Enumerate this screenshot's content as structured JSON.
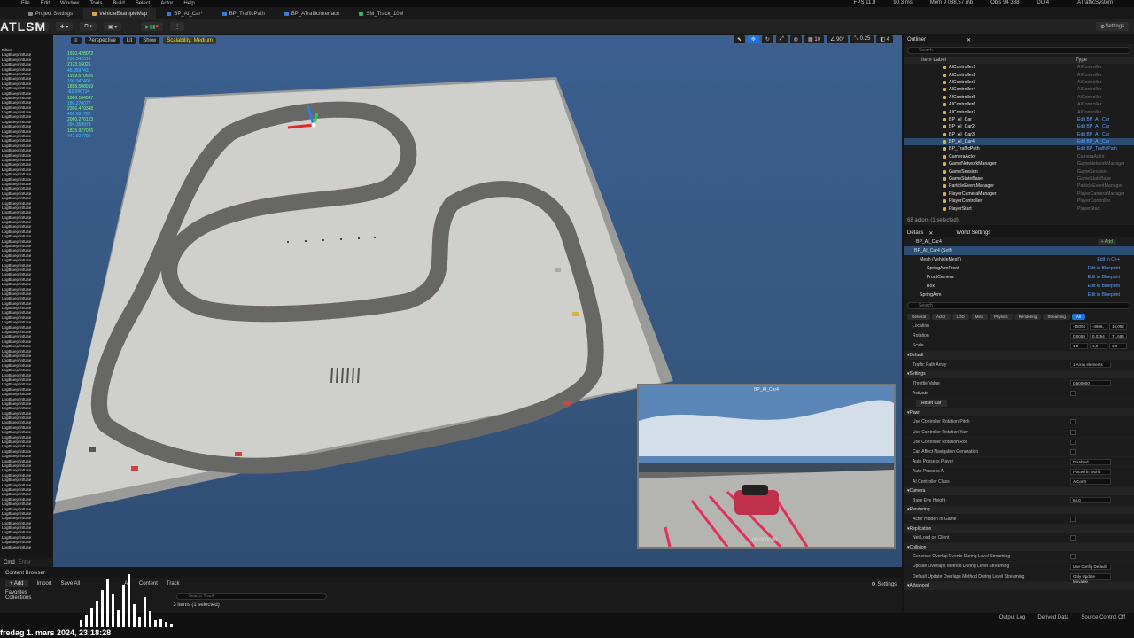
{
  "menu": [
    "File",
    "Edit",
    "Window",
    "Tools",
    "Build",
    "Select",
    "Actor",
    "Help"
  ],
  "stats": {
    "fps": "FPS 11,8",
    "ms": "90,3 ms",
    "mem": "Mem 9 088,57 mb",
    "objs": "Objs 94 388",
    "du": "DU 4",
    "project": "ATrafficSystem"
  },
  "tabs": [
    {
      "label": "Project Settings",
      "color": "#888888"
    },
    {
      "label": "VehicleExampleMap",
      "color": "#e0a34a"
    },
    {
      "label": "BP_AI_Car*",
      "color": "#3a7bd5"
    },
    {
      "label": "BP_TrafficPath",
      "color": "#3a7bd5"
    },
    {
      "label": "BP_ATrafficInterface",
      "color": "#3a7bd5"
    },
    {
      "label": "SM_Track_10M",
      "color": "#3ab06a"
    }
  ],
  "toolbar": {
    "mode_label": "No",
    "settings_label": "Settings"
  },
  "logo_text": "ATLSM",
  "viewport": {
    "perspective": "Perspective",
    "lit": "Lit",
    "show": "Show",
    "scalability": "Scalability: Medium",
    "angle": "90°",
    "scale": "0.25",
    "grid": "10",
    "layers": "4"
  },
  "numbers": [
    "1920.428072",
    "236.342519",
    "2123.16026",
    "45.959743",
    "1919.670626",
    "100.947408",
    "1858.508919",
    "-82.096734",
    "1860.164087",
    "180.270077",
    "2366.479348",
    "409.891762",
    "2060.276123",
    "394.359978",
    "1835.927026",
    "447.924709"
  ],
  "log_line": "LogBlueprintUse",
  "log_count": 104,
  "filters_label": "Filters",
  "cmd": {
    "cmd": "Cmd",
    "input": "Enter"
  },
  "pip": {
    "title": "BP_AI_Car4",
    "speed": "00.000000"
  },
  "outliner": {
    "title": "Outliner",
    "search": "Search",
    "col_label": "Item Label",
    "col_type": "Type",
    "rows": [
      {
        "label": "AIController1",
        "type": "AIController",
        "link": false
      },
      {
        "label": "AIController2",
        "type": "AIController",
        "link": false
      },
      {
        "label": "AIController3",
        "type": "AIController",
        "link": false
      },
      {
        "label": "AIController4",
        "type": "AIController",
        "link": false
      },
      {
        "label": "AIController5",
        "type": "AIController",
        "link": false
      },
      {
        "label": "AIController6",
        "type": "AIController",
        "link": false
      },
      {
        "label": "AIController7",
        "type": "AIController",
        "link": false
      },
      {
        "label": "BP_AI_Car",
        "type": "Edit BP_AI_Car",
        "link": true
      },
      {
        "label": "BP_AI_Car2",
        "type": "Edit BP_AI_Car",
        "link": true
      },
      {
        "label": "BP_AI_Car3",
        "type": "Edit BP_AI_Car",
        "link": true
      },
      {
        "label": "BP_AI_Car4",
        "type": "Edit BP_AI_Car",
        "link": true,
        "selected": true
      },
      {
        "label": "BP_TrafficPath",
        "type": "Edit BP_TrafficPath",
        "link": true
      },
      {
        "label": "CameraActor",
        "type": "CameraActor",
        "link": false
      },
      {
        "label": "GameNetworkManager",
        "type": "GameNetworkManager",
        "link": false
      },
      {
        "label": "GameSession",
        "type": "GameSession",
        "link": false
      },
      {
        "label": "GameStateBase",
        "type": "GameStateBase",
        "link": false
      },
      {
        "label": "ParticleEventManager",
        "type": "ParticleEventManager",
        "link": false
      },
      {
        "label": "PlayerCameraManager",
        "type": "PlayerCameraManager",
        "link": false
      },
      {
        "label": "PlayerController",
        "type": "PlayerController",
        "link": false
      },
      {
        "label": "PlayerStart",
        "type": "PlayerStart",
        "link": false
      }
    ],
    "footer": "68 actors (1 selected)"
  },
  "details": {
    "tab": "Details",
    "tab2": "World Settings",
    "actor": "BP_AI_Car4",
    "add": "+ Add",
    "self": "BP_AI_Car4 (Self)",
    "components": [
      {
        "label": "Mesh (VehicleMesh)",
        "link": "Edit in C++"
      },
      {
        "label": "SpringArmFront",
        "link": "Edit in Blueprint"
      },
      {
        "label": "FrontCamera",
        "link": "Edit in Blueprint"
      },
      {
        "label": "Box",
        "link": "Edit in Blueprint"
      },
      {
        "label": "SpringArm",
        "link": "Edit in Blueprint"
      }
    ],
    "search": "Search",
    "filters": [
      "General",
      "Actor",
      "LOD",
      "Misc",
      "Physics",
      "Rendering",
      "Streaming",
      "All"
    ],
    "transform": [
      {
        "label": "Location",
        "vals": [
          "-15004",
          "-4866,",
          "16,052"
        ]
      },
      {
        "label": "Rotation",
        "vals": [
          "0,0059",
          "0,0294",
          "71,696"
        ]
      },
      {
        "label": "Scale",
        "vals": [
          "1,0",
          "1,0",
          "1,0"
        ]
      }
    ],
    "sections": [
      {
        "cat": "Default",
        "rows": [
          {
            "label": "Traffic Path Array",
            "val": "1 Array elements"
          }
        ]
      },
      {
        "cat": "Settings",
        "rows": [
          {
            "label": "Throttle Value",
            "val": "0,500000"
          },
          {
            "label": "Activate",
            "check": true
          },
          {
            "label": "Reset Car",
            "button": true
          }
        ]
      },
      {
        "cat": "Pawn",
        "rows": [
          {
            "label": "Use Controller Rotation Pitch",
            "check": true
          },
          {
            "label": "Use Controller Rotation Yaw",
            "check": true
          },
          {
            "label": "Use Controller Rotation Roll",
            "check": true
          },
          {
            "label": "Can Affect Navigation Generation",
            "check": true
          },
          {
            "label": "Auto Possess Player",
            "val": "Disabled"
          },
          {
            "label": "Auto Possess AI",
            "val": "Placed in World"
          },
          {
            "label": "AI Controller Class",
            "val": "AIContr"
          }
        ]
      },
      {
        "cat": "Camera",
        "rows": [
          {
            "label": "Base Eye Height",
            "val": "64,0"
          }
        ]
      },
      {
        "cat": "Rendering",
        "rows": [
          {
            "label": "Actor Hidden In Game",
            "check": true
          }
        ]
      },
      {
        "cat": "Replication",
        "rows": [
          {
            "label": "Net Load on Client",
            "check": true
          }
        ]
      },
      {
        "cat": "Collision",
        "rows": [
          {
            "label": "Generate Overlap Events During Level Streaming",
            "check": true
          },
          {
            "label": "Update Overlaps Method During Level Streaming",
            "val": "Use Config Default"
          },
          {
            "label": "Default Update Overlaps Method During Level Streaming",
            "val": "Only Update Movable"
          }
        ]
      },
      {
        "cat": "Advanced",
        "rows": []
      }
    ]
  },
  "content_browser": {
    "title": "Content Browser",
    "add": "+ Add",
    "import": "Import",
    "save": "Save All",
    "crumbs": [
      "All",
      "Content",
      "Track"
    ],
    "settings": "Settings",
    "search": "Search Track",
    "favorites": "Favorites",
    "collections": "Collections",
    "status": "3 items (1 selected)"
  },
  "statusbar": {
    "derived": "Derived Data",
    "source": "Source Control Off",
    "cmd": "Output Log"
  },
  "datetime": "fredag 1. mars 2024, 23:18:28",
  "colors": {
    "accent": "#1d74d8",
    "selection": "#2a4d73",
    "link": "#5aa1ff"
  }
}
